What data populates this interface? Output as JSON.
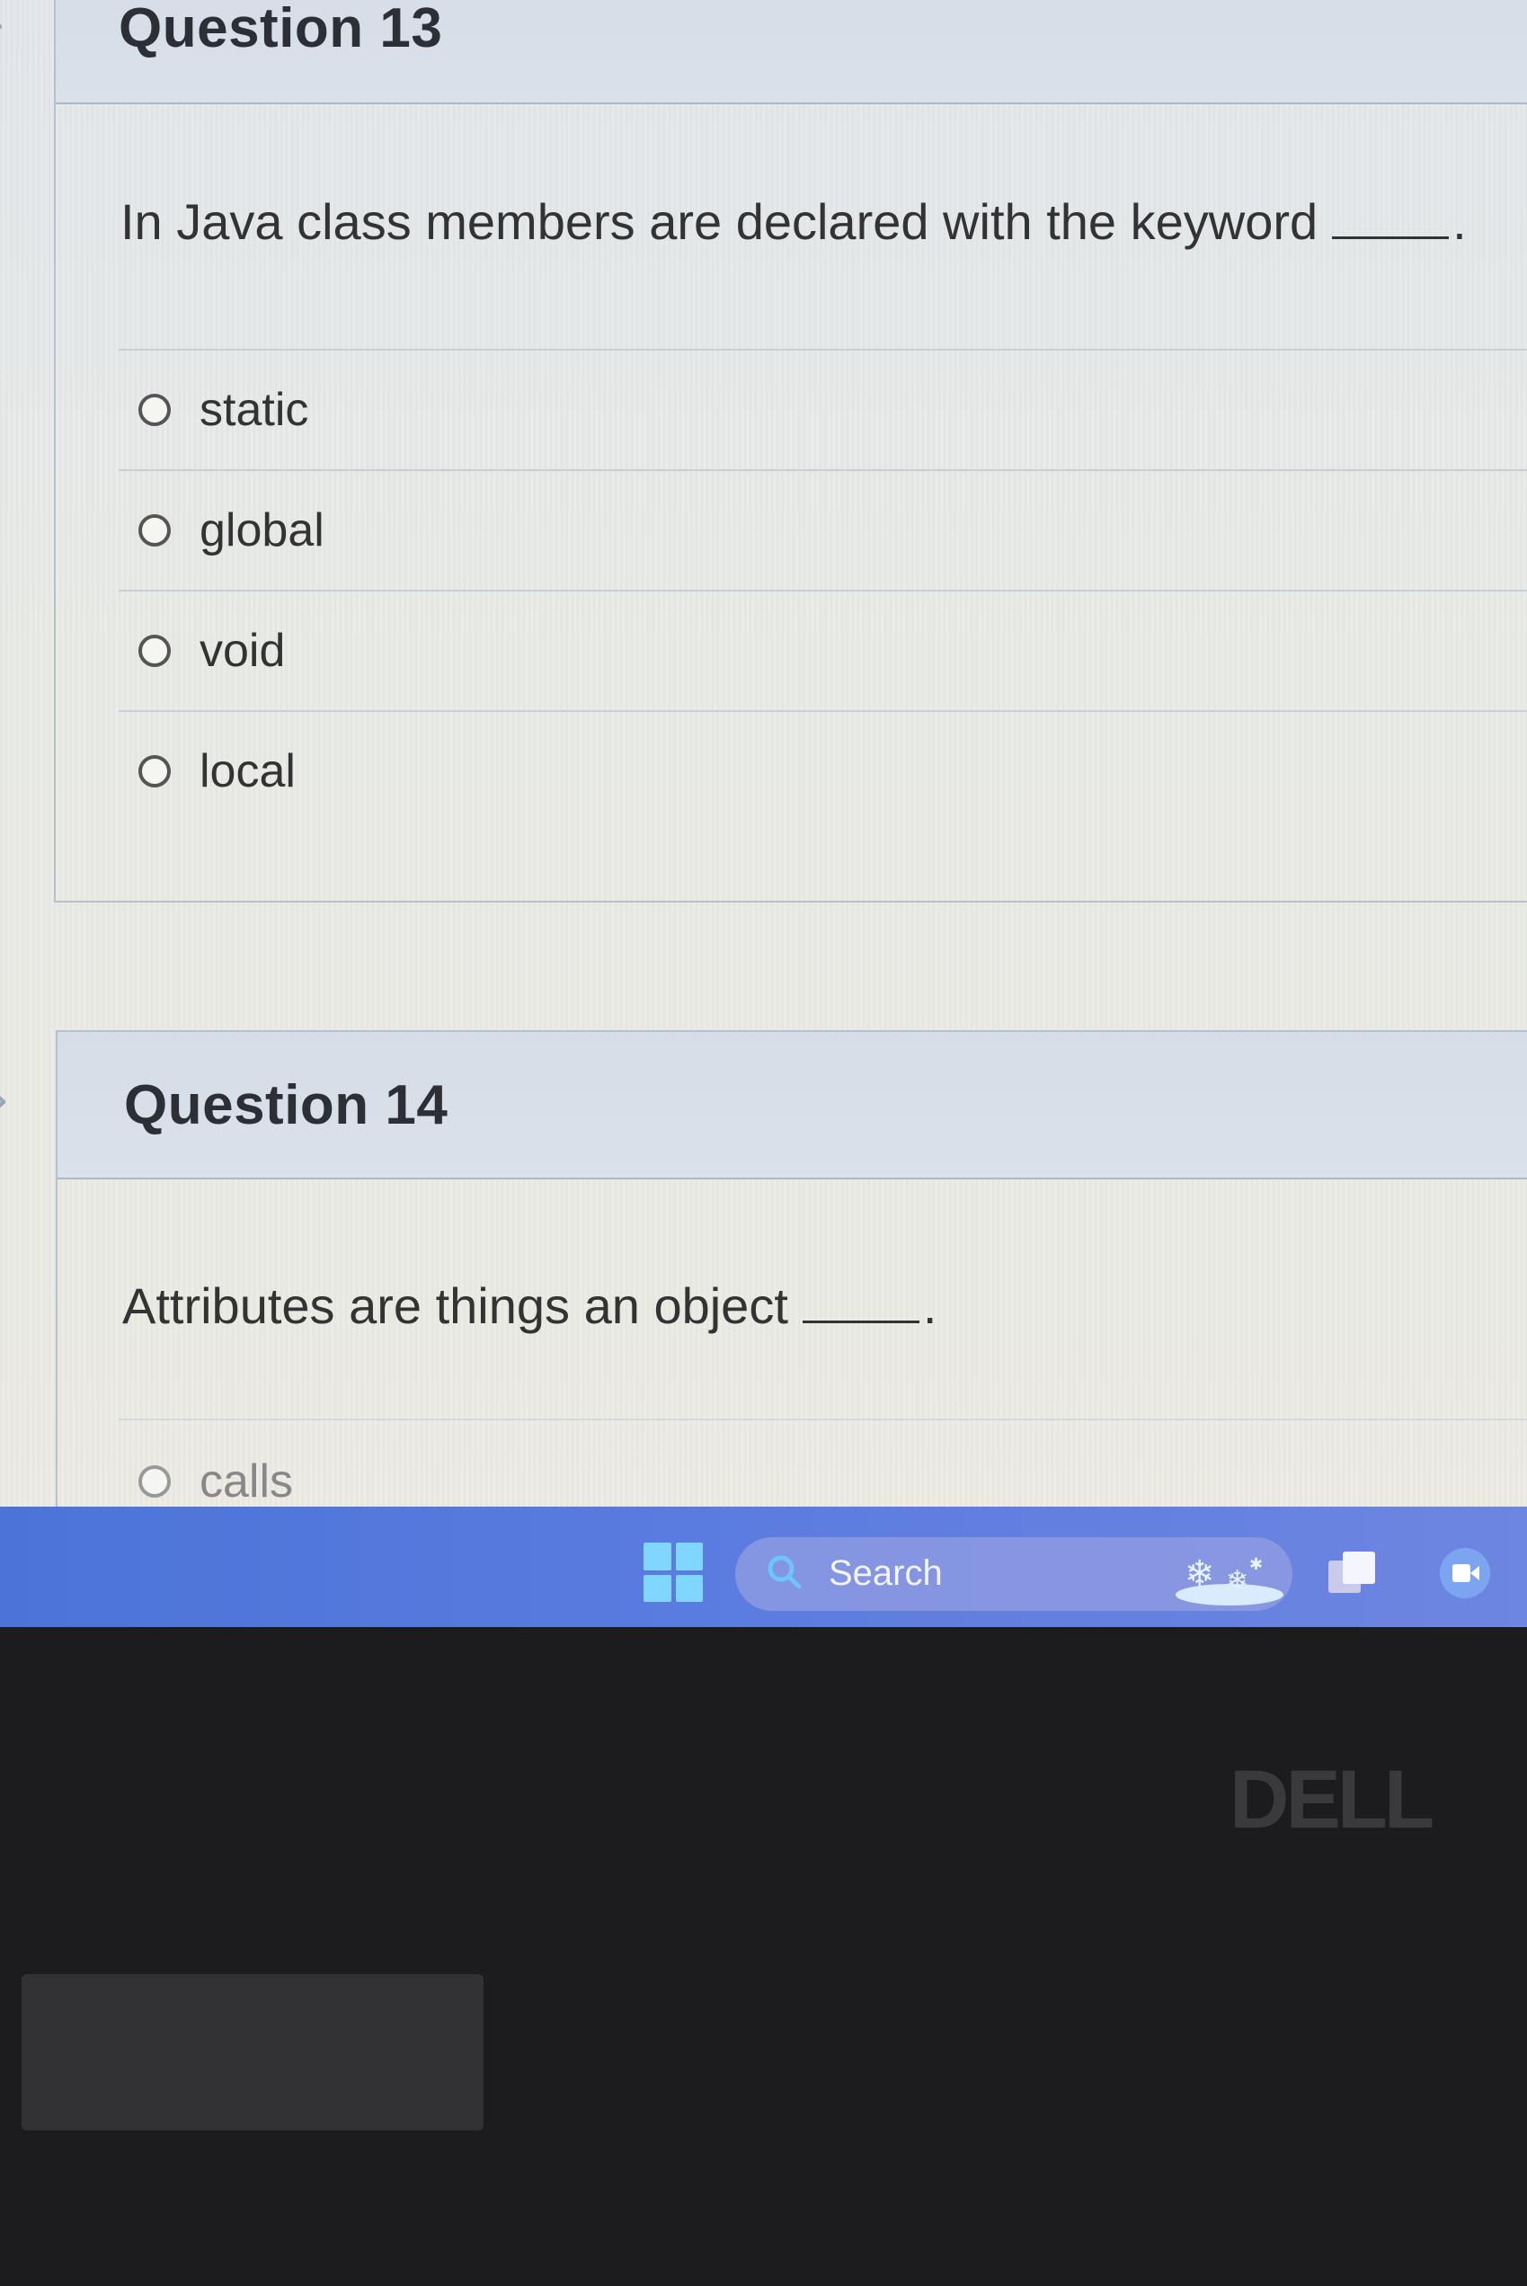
{
  "question13": {
    "title": "Question 13",
    "prompt": "In Java class members are declared with the keyword",
    "prompt_end": ".",
    "options": [
      "static",
      "global",
      "void",
      "local"
    ]
  },
  "question14": {
    "title": "Question 14",
    "prompt": "Attributes are things an object",
    "prompt_end": ".",
    "options": [
      "calls"
    ]
  },
  "taskbar": {
    "search_label": "Search"
  },
  "bezel": {
    "brand": "DELL"
  },
  "colors": {
    "taskbar": "#5a7be0",
    "windows_logo": "#7fd6ff"
  }
}
